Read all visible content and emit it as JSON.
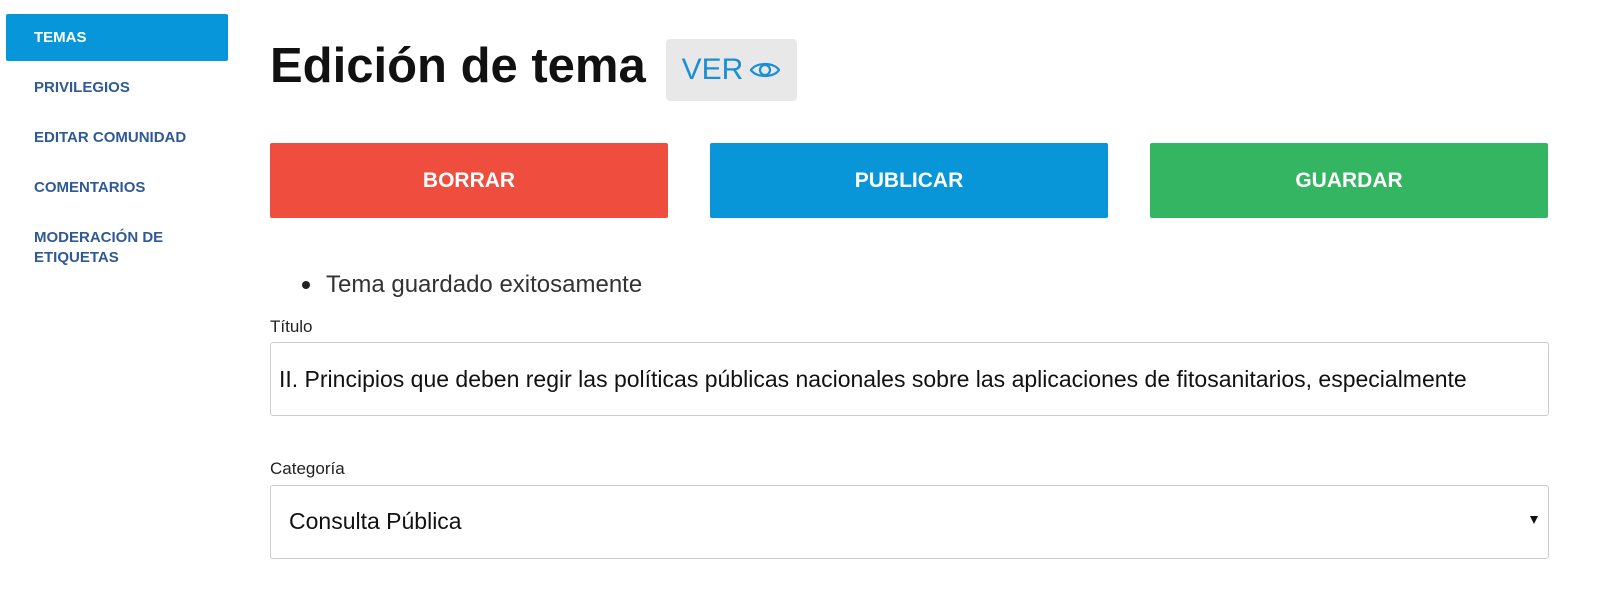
{
  "sidebar": {
    "items": [
      {
        "label": "TEMAS"
      },
      {
        "label": "PRIVILEGIOS"
      },
      {
        "label": "EDITAR COMUNIDAD"
      },
      {
        "label": "COMENTARIOS"
      },
      {
        "label": "MODERACIÓN DE ETIQUETAS"
      }
    ],
    "active_color": "#0796d9",
    "item_color": "#2f5a97"
  },
  "header": {
    "title": "Edición de tema",
    "view_label": "VER",
    "view_icon": "eye-icon"
  },
  "actions": {
    "delete_label": "BORRAR",
    "publish_label": "PUBLICAR",
    "save_label": "GUARDAR",
    "delete_color": "#ef4e3e",
    "publish_color": "#0896d9",
    "save_color": "#34b561"
  },
  "notices": [
    "Tema guardado exitosamente"
  ],
  "form": {
    "title_label": "Título",
    "title_value": "II. Principios que deben regir las políticas públicas nacionales sobre las aplicaciones de fitosanitarios, especialmente",
    "category_label": "Categoría",
    "category_value": "Consulta Pública"
  }
}
